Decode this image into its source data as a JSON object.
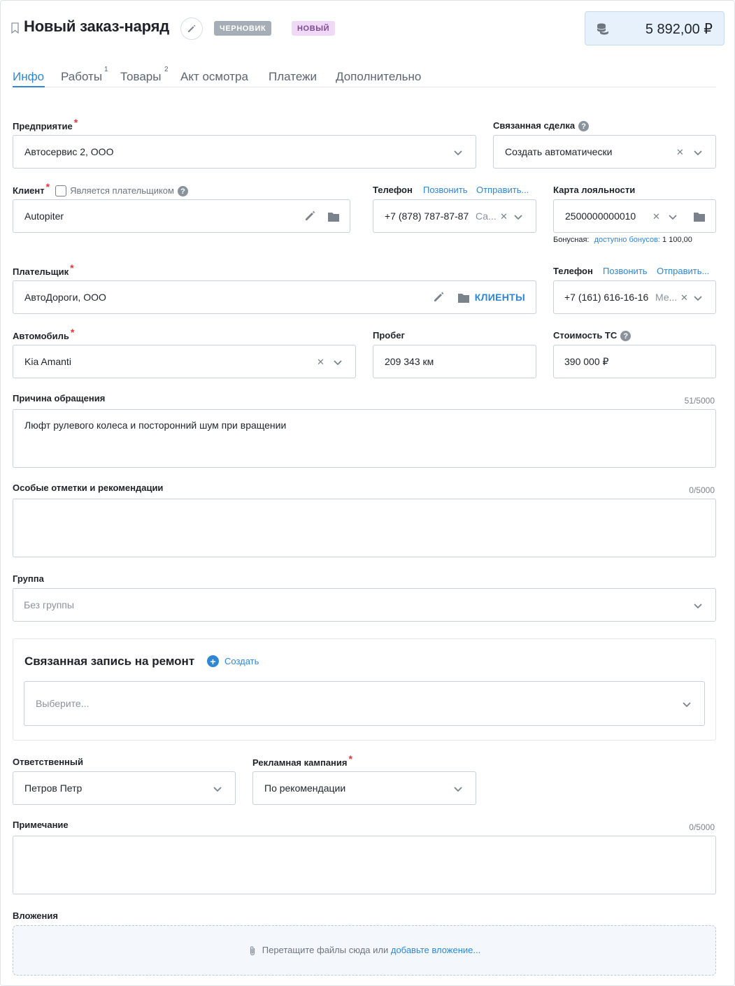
{
  "header": {
    "title": "Новый заказ-наряд",
    "badges": {
      "draft": "ЧЕРНОВИК",
      "new": "НОВЫЙ"
    },
    "total": "5 892,00 ₽"
  },
  "tabs": [
    {
      "label": "Инфо",
      "active": true
    },
    {
      "label": "Работы",
      "count": "1"
    },
    {
      "label": "Товары",
      "count": "2"
    },
    {
      "label": "Акт осмотра"
    },
    {
      "label": "Платежи"
    },
    {
      "label": "Дополнительно"
    }
  ],
  "company": {
    "label": "Предприятие",
    "value": "Автосервис 2, ООО"
  },
  "deal": {
    "label": "Связанная сделка",
    "value": "Создать автоматически",
    "help": "?"
  },
  "client": {
    "label": "Клиент",
    "is_payer_label": "Является плательщиком",
    "help": "?",
    "value": "Autopiter"
  },
  "client_phone": {
    "label": "Телефон",
    "call": "Позвонить",
    "send": "Отправить...",
    "value": "+7 (878) 787-87-87",
    "type": "Са..."
  },
  "loyalty": {
    "label": "Карта лояльности",
    "value": "2500000000010",
    "bonus_prefix": "Бонусная:",
    "bonus_link": "доступно бонусов:",
    "bonus_value": "1 100,00"
  },
  "payer": {
    "label": "Плательщик",
    "value": "АвтоДороги, ООО",
    "clients_button": "КЛИЕНТЫ"
  },
  "payer_phone": {
    "label": "Телефон",
    "call": "Позвонить",
    "send": "Отправить...",
    "value": "+7 (161) 616-16-16",
    "type": "Ме..."
  },
  "car": {
    "label": "Автомобиль",
    "value": "Kia Amanti"
  },
  "mileage": {
    "label": "Пробег",
    "value": "209 343 км"
  },
  "car_cost": {
    "label": "Стоимость ТС",
    "value": "390 000 ₽",
    "help": "?"
  },
  "reason": {
    "label": "Причина обращения",
    "counter": "51/5000",
    "value": "Люфт рулевого колеса и посторонний шум при вращении"
  },
  "notes_special": {
    "label": "Особые отметки и рекомендации",
    "counter": "0/5000",
    "value": ""
  },
  "group": {
    "label": "Группа",
    "placeholder": "Без группы"
  },
  "repair_record": {
    "title": "Связанная запись на ремонт",
    "create": "Создать",
    "placeholder": "Выберите..."
  },
  "responsible": {
    "label": "Ответственный",
    "value": "Петров Петр"
  },
  "campaign": {
    "label": "Рекламная кампания",
    "value": "По рекомендации"
  },
  "note": {
    "label": "Примечание",
    "counter": "0/5000",
    "value": ""
  },
  "attachments": {
    "label": "Вложения",
    "drop_text": "Перетащите файлы сюда или",
    "add_link": "добавьте вложение..."
  },
  "colors": {
    "accent": "#2f86d5",
    "required": "#e5343a",
    "draft_badge": "#a5adb6",
    "new_badge": "#efd9f6",
    "total_bg": "#e7f1fb"
  }
}
